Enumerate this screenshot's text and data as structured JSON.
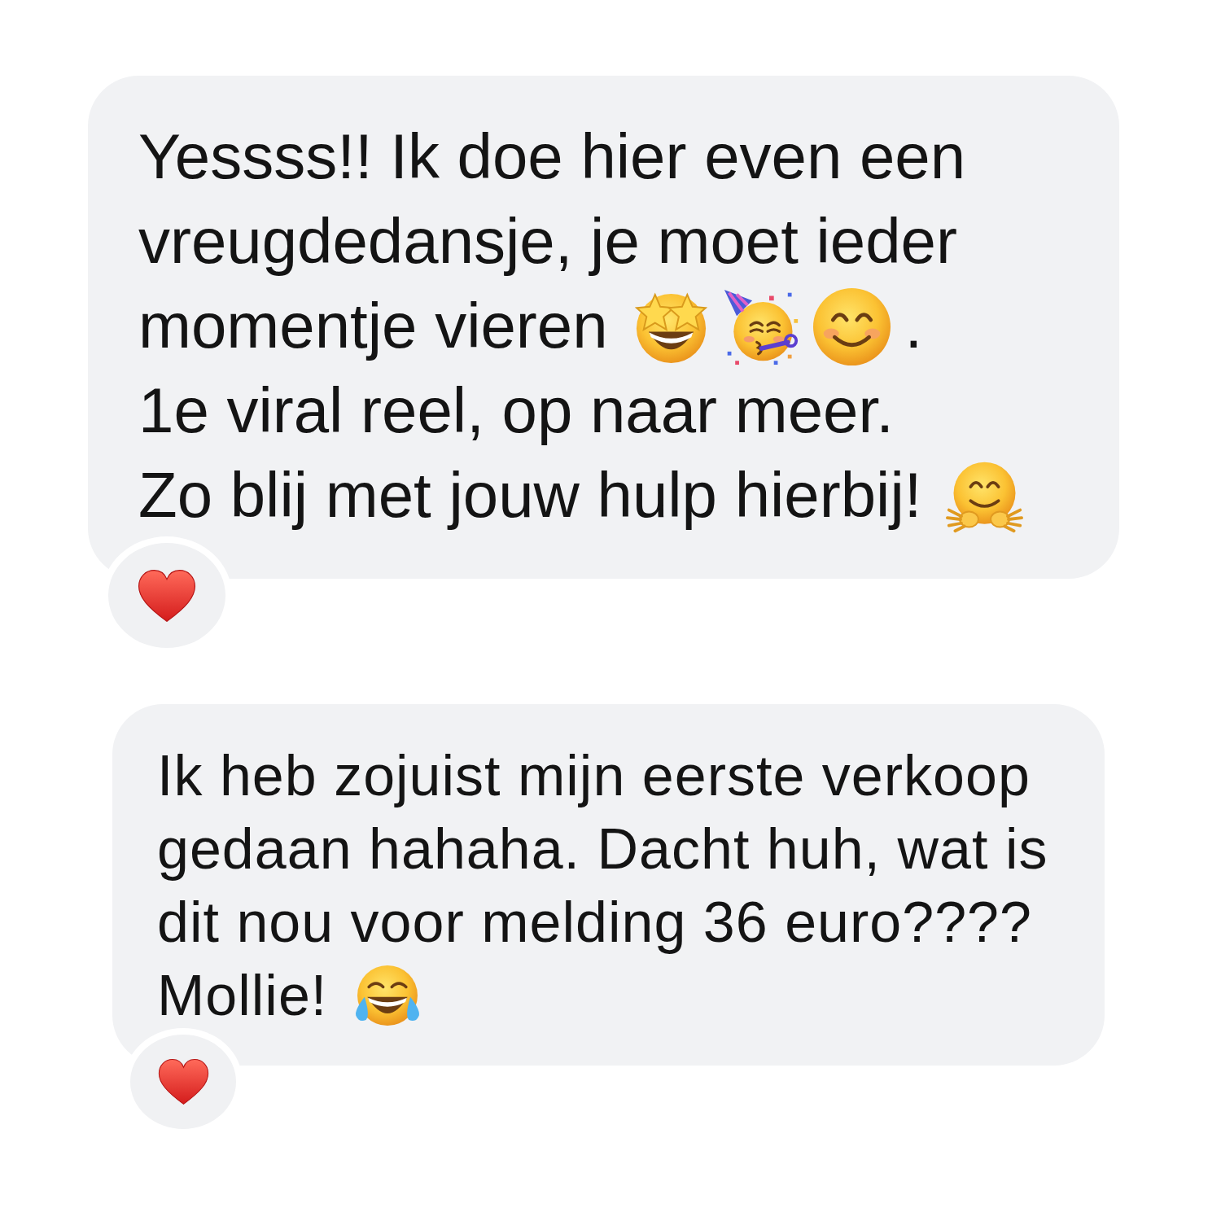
{
  "messages": [
    {
      "lines": [
        [
          {
            "kind": "text",
            "text": "Yessss!! Ik doe hier even een"
          }
        ],
        [
          {
            "kind": "text",
            "text": "vreugdedansje, je moet ieder"
          }
        ],
        [
          {
            "kind": "text",
            "text": "momentje vieren"
          },
          {
            "kind": "star_struck"
          },
          {
            "kind": "partying"
          },
          {
            "kind": "smiling"
          },
          {
            "kind": "text",
            "text": "."
          }
        ],
        [
          {
            "kind": "text",
            "text": "1e viral reel, op naar meer."
          }
        ],
        [
          {
            "kind": "text",
            "text": "Zo blij met jouw hulp hierbij!"
          },
          {
            "kind": "hugging"
          }
        ]
      ],
      "reaction": {
        "kind": "heart"
      }
    },
    {
      "lines": [
        [
          {
            "kind": "text",
            "text": "Ik heb zojuist mijn eerste verkoop"
          }
        ],
        [
          {
            "kind": "text",
            "text": "gedaan hahaha. Dacht huh, wat is"
          }
        ],
        [
          {
            "kind": "text",
            "text": "dit nou voor melding 36 euro????"
          }
        ],
        [
          {
            "kind": "text",
            "text": "Mollie!"
          },
          {
            "kind": "laughing"
          }
        ]
      ],
      "reaction": {
        "kind": "heart"
      }
    }
  ]
}
